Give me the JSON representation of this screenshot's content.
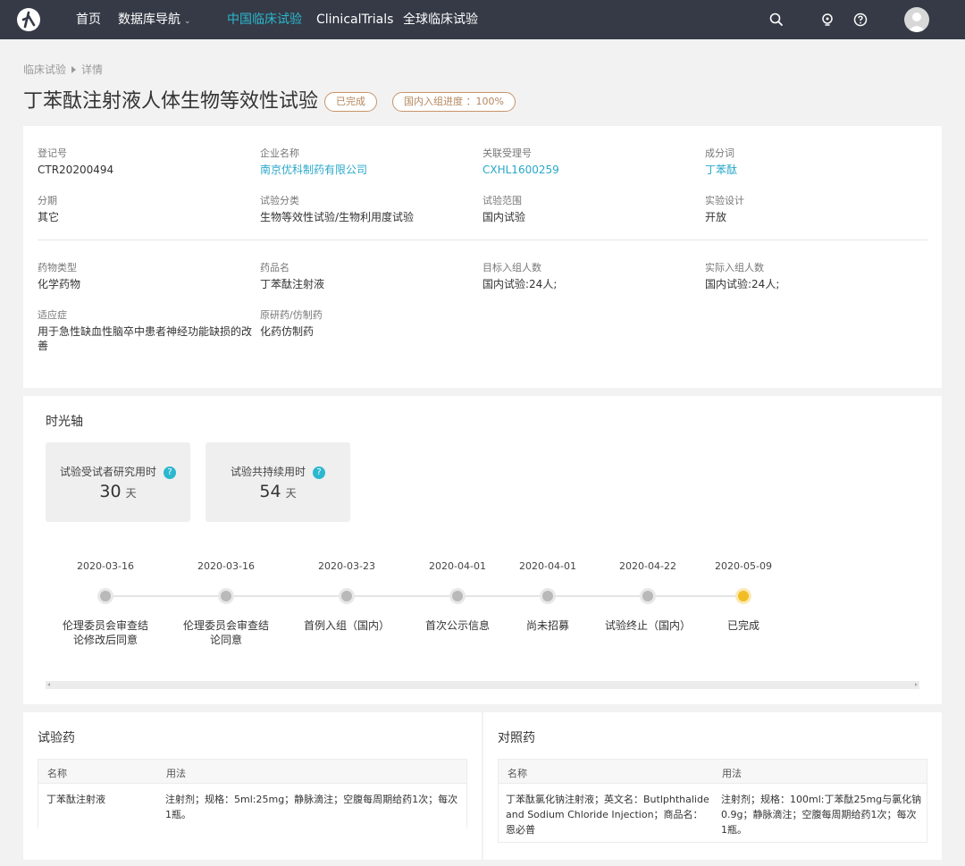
{
  "nav": {
    "items": [
      "首页",
      "数据库导航",
      "中国临床试验",
      "ClinicalTrials",
      "全球临床试验"
    ]
  },
  "breadcrumb": {
    "root": "临床试验",
    "current": "详情"
  },
  "title": "丁苯酞注射液人体生物等效性试验",
  "tags": {
    "status": "已完成",
    "enrollment": "国内入组进度 ：100%"
  },
  "info": {
    "fields": [
      {
        "label": "登记号",
        "value": "CTR20200494"
      },
      {
        "label": "企业名称",
        "value": "南京优科制药有限公司"
      },
      {
        "label": "关联受理号",
        "value": "CXHL1600259"
      },
      {
        "label": "成分词",
        "value": "丁苯酞"
      },
      {
        "label": "分期",
        "value": "其它"
      },
      {
        "label": "试验分类",
        "value": "生物等效性试验/生物利用度试验"
      },
      {
        "label": "试验范围",
        "value": "国内试验"
      },
      {
        "label": "实验设计",
        "value": "开放"
      },
      {
        "label": "药物类型",
        "value": "化学药物"
      },
      {
        "label": "药品名",
        "value": "丁苯酞注射液"
      },
      {
        "label": "目标入组人数",
        "value": "国内试验:24人;"
      },
      {
        "label": "实际入组人数",
        "value": "国内试验:24人;"
      },
      {
        "label": "适应症",
        "value": "用于急性缺血性脑卒中患者神经功能缺损的改善"
      },
      {
        "label": "原研药/仿制药",
        "value": "化药仿制药"
      }
    ]
  },
  "timeline": {
    "title": "时光轴",
    "stats": [
      {
        "label": "试验受试者研究用时",
        "value": "30",
        "unit": "天"
      },
      {
        "label": "试验共持续用时",
        "value": "54",
        "unit": "天"
      }
    ],
    "events": [
      {
        "date": "2020-03-16",
        "label": "伦理委员会审查结论修改后同意",
        "done": false
      },
      {
        "date": "2020-03-16",
        "label": "伦理委员会审查结论同意",
        "done": false
      },
      {
        "date": "2020-03-23",
        "label": "首例入组（国内）",
        "done": false
      },
      {
        "date": "2020-04-01",
        "label": "首次公示信息",
        "done": false
      },
      {
        "date": "2020-04-01",
        "label": "尚未招募",
        "done": false
      },
      {
        "date": "2020-04-22",
        "label": "试验终止（国内）",
        "done": false
      },
      {
        "date": "2020-05-09",
        "label": "已完成",
        "done": true
      }
    ]
  },
  "test_drug": {
    "title": "试验药",
    "headers": [
      "名称",
      "用法"
    ],
    "rows": [
      [
        "丁苯酞注射液",
        "注射剂；规格：5ml:25mg；静脉滴注；空腹每周期给药1次；每次1瓶。"
      ]
    ]
  },
  "control_drug": {
    "title": "对照药",
    "headers": [
      "名称",
      "用法"
    ],
    "rows": [
      [
        "丁苯酞氯化钠注射液；英文名：Butlphthalide and Sodium Chloride Injection；商品名：恩必普",
        "注射剂；规格：100ml:丁苯酞25mg与氯化钠0.9g；静脉滴注；空腹每周期给药1次；每次1瓶。"
      ]
    ]
  },
  "colors": {
    "nav_bg": "#353a46",
    "accent": "#2bb8cf",
    "link": "#2aa7c9",
    "tag": "#c8946a",
    "done_dot": "#f2bd24"
  }
}
